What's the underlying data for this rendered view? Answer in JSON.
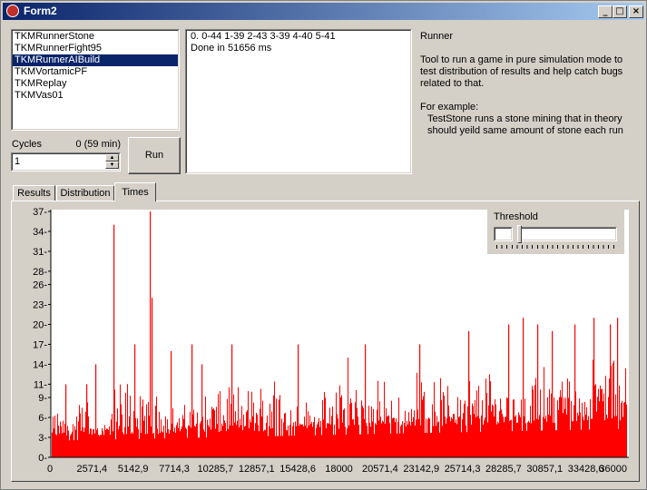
{
  "window": {
    "title": "Form2"
  },
  "runners": {
    "items": [
      "TKMRunnerStone",
      "TKMRunnerFight95",
      "TKMRunnerAIBuild",
      "TKMVortamicPF",
      "TKMReplay",
      "TKMVas01"
    ],
    "selected_index": 2
  },
  "log": {
    "lines": [
      "0. 0-44 1-39 2-43 3-39 4-40 5-41",
      "Done in 51656 ms"
    ]
  },
  "description": {
    "title": "Runner",
    "body": "Tool to run a game in pure simulation mode to test distribution of results and help catch bugs related to that.",
    "example_heading": "For example:",
    "example_text": "TestStone runs a stone mining that in theory should yeild same amount of stone each run"
  },
  "cycles": {
    "label": "Cycles",
    "info": "0 (59 min)",
    "value": "1"
  },
  "run_button": {
    "label": "Run"
  },
  "tabs": [
    {
      "label": "Results",
      "active": false
    },
    {
      "label": "Distribution",
      "active": false
    },
    {
      "label": "Times",
      "active": true
    }
  ],
  "threshold": {
    "label": "Threshold",
    "value": "",
    "level": 0
  },
  "colors": {
    "bar": "#ff0000",
    "selection": "#0a246a",
    "face": "#d4d0c8"
  },
  "chart_data": {
    "type": "bar",
    "title": "",
    "xlabel": "",
    "ylabel": "",
    "xlim": [
      0,
      36000
    ],
    "ylim": [
      0,
      37
    ],
    "y_ticks": [
      0,
      3,
      6,
      9,
      11,
      14,
      17,
      20,
      23,
      26,
      28,
      31,
      34,
      37
    ],
    "x_ticks": [
      {
        "value": 0,
        "label": "0"
      },
      {
        "value": 2571.4,
        "label": "2571,4"
      },
      {
        "value": 5142.9,
        "label": "5142,9"
      },
      {
        "value": 7714.3,
        "label": "7714,3"
      },
      {
        "value": 10285.7,
        "label": "10285,7"
      },
      {
        "value": 12857.1,
        "label": "12857,1"
      },
      {
        "value": 15428.6,
        "label": "15428,6"
      },
      {
        "value": 18000,
        "label": "18000"
      },
      {
        "value": 20571.4,
        "label": "20571,4"
      },
      {
        "value": 23142.9,
        "label": "23142,9"
      },
      {
        "value": 25714.3,
        "label": "25714,3"
      },
      {
        "value": 28285.7,
        "label": "28285,7"
      },
      {
        "value": 30857.1,
        "label": "30857,1"
      },
      {
        "value": 33428.6,
        "label": "33428,6"
      },
      {
        "value": 36000,
        "label": "36000"
      }
    ],
    "series": [
      {
        "x_start": 0,
        "x_step": 1200,
        "values": [
          7,
          9,
          6,
          12,
          10,
          10,
          8,
          10,
          11,
          11,
          11,
          14,
          10,
          9,
          10,
          16,
          10,
          12,
          10,
          13,
          12,
          12,
          13,
          12,
          12,
          14,
          14,
          12,
          15,
          15
        ]
      },
      {
        "x_points": [
          3900,
          6200,
          6300,
          900,
          2200,
          2800,
          5200,
          7500,
          8800,
          9400,
          11300,
          15400,
          19600,
          23000,
          26100,
          28600,
          29500,
          30400,
          31300,
          32700,
          33900,
          34900,
          35400
        ],
        "values": [
          35,
          37,
          24,
          11,
          11,
          14,
          17,
          16,
          17,
          14,
          17,
          17,
          17,
          17,
          19,
          20,
          21,
          20,
          19,
          20,
          21,
          20,
          21
        ]
      }
    ]
  }
}
